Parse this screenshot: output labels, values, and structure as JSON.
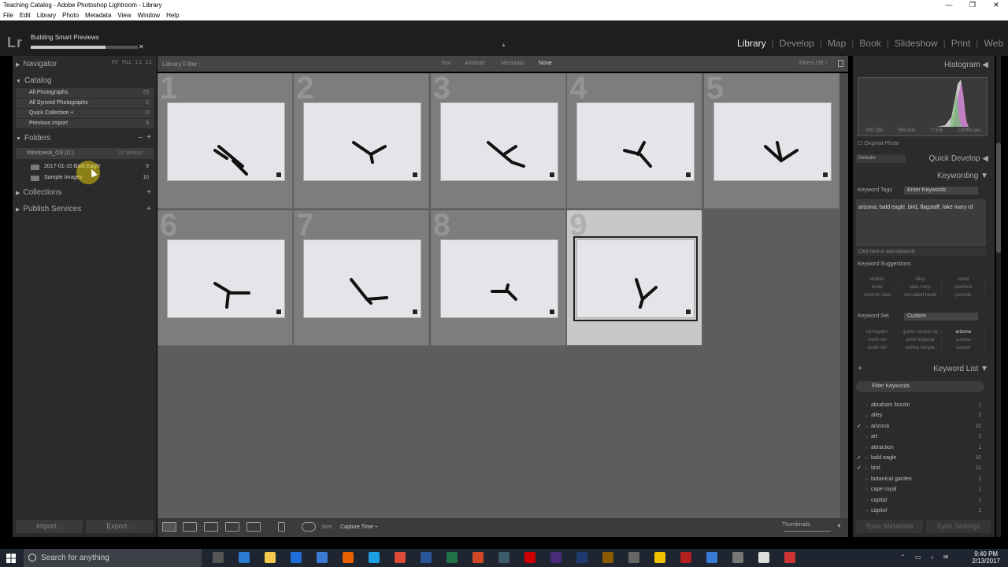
{
  "window": {
    "title": "Teaching Catalog - Adobe Photoshop Lightroom - Library",
    "minimize": "—",
    "maximize": "❐",
    "close": "✕"
  },
  "menu": [
    "File",
    "Edit",
    "Library",
    "Photo",
    "Metadata",
    "View",
    "Window",
    "Help"
  ],
  "top": {
    "logo": "Lr",
    "task": "Building Smart Previews",
    "task_progress": 0.7,
    "task_close": "✕",
    "modules": [
      "Library",
      "Develop",
      "Map",
      "Book",
      "Slideshow",
      "Print",
      "Web"
    ],
    "active_module": "Library"
  },
  "left": {
    "navigator": "Navigator",
    "nav_zoom": "FIT  FILL  1:1  2:1",
    "catalog": "Catalog",
    "catalog_items": [
      {
        "label": "All Photographs",
        "count": "25"
      },
      {
        "label": "All Synced Photographs",
        "count": "0"
      },
      {
        "label": "Quick Collection +",
        "count": "0"
      },
      {
        "label": "Previous Import",
        "count": "9"
      }
    ],
    "folders": "Folders",
    "folders_minus": "–",
    "folders_plus": "+",
    "drive": {
      "label": "Windows8_OS (C:)",
      "count": "22 photos"
    },
    "folder_items": [
      {
        "label": "2017-01-15 Bald Eagle",
        "count": "9"
      },
      {
        "label": "Sample Images",
        "count": "16"
      }
    ],
    "collections": "Collections",
    "collections_plus": "+",
    "publish": "Publish Services",
    "publish_plus": "+",
    "import": "Import...",
    "export": "Export..."
  },
  "filter": {
    "label": "Library Filter :",
    "options": [
      "Text",
      "Attribute",
      "Metadata",
      "None"
    ],
    "active": "None",
    "filters_off": "Filters Off ÷"
  },
  "grid": {
    "cells": [
      {
        "num": "1",
        "selected": false
      },
      {
        "num": "2",
        "selected": false
      },
      {
        "num": "3",
        "selected": false
      },
      {
        "num": "4",
        "selected": false
      },
      {
        "num": "5",
        "selected": false
      },
      {
        "num": "6",
        "selected": false
      },
      {
        "num": "7",
        "selected": false
      },
      {
        "num": "8",
        "selected": false
      },
      {
        "num": "9",
        "selected": true
      }
    ]
  },
  "toolbar": {
    "sort_label": "Sort:",
    "sort_value": "Capture Time ÷",
    "thumbnails": "Thumbnails"
  },
  "right": {
    "histogram": "Histogram",
    "exif": [
      "ISO 280",
      "500 mm",
      "f / 5.6",
      "1/2000 sec"
    ],
    "original_photo": "Original Photo",
    "defaults": "Defaults",
    "quick_develop": "Quick Develop",
    "keywording": "Keywording",
    "keyword_tags_label": "Keyword Tags",
    "keyword_tags_mode": "Enter Keywords",
    "keywords_text": "arizona, bald eagle, bird, flagstaff, lake mary rd",
    "add_hint": "Click here to add keywords",
    "suggestions_label": "Keyword Suggestions",
    "suggestions": [
      "wildlife",
      "alley",
      "street",
      "lower",
      "lake mary",
      "overlook",
      "mormon lake",
      "red-tailed hawk",
      "juvenile"
    ],
    "keyword_set_label": "Keyword Set",
    "keyword_set_value": "Custom",
    "keyword_set": [
      "mt hayden",
      "grand canyon np",
      "arizona",
      "north rim",
      "point imperial",
      "sunrise",
      "south rim",
      "vishnu temple",
      "sunset"
    ],
    "keyword_set_highlight": "arizona",
    "keyword_list": "Keyword List",
    "keyword_list_plus": "+",
    "filter_keywords": "Filter Keywords",
    "keywords": [
      {
        "name": "abraham lincoln",
        "count": "1",
        "checked": false
      },
      {
        "name": "alley",
        "count": "2",
        "checked": false
      },
      {
        "name": "arizona",
        "count": "10",
        "checked": true
      },
      {
        "name": "art",
        "count": "1",
        "checked": false
      },
      {
        "name": "attraction",
        "count": "1",
        "checked": false
      },
      {
        "name": "bald eagle",
        "count": "10",
        "checked": true
      },
      {
        "name": "bird",
        "count": "11",
        "checked": true
      },
      {
        "name": "botanical garden",
        "count": "1",
        "checked": false
      },
      {
        "name": "cape royal",
        "count": "1",
        "checked": false
      },
      {
        "name": "capital",
        "count": "1",
        "checked": false
      },
      {
        "name": "capitol",
        "count": "1",
        "checked": false
      }
    ],
    "sync_metadata": "Sync Metadata",
    "sync_settings": "Sync Settings"
  },
  "taskbar": {
    "search": "Search for anything",
    "time": "9:40 PM",
    "date": "2/13/2017"
  },
  "colors": {
    "accent_cursor": "#ffe600",
    "panel": "#2b2b2b",
    "grid": "#5d5d5d"
  }
}
